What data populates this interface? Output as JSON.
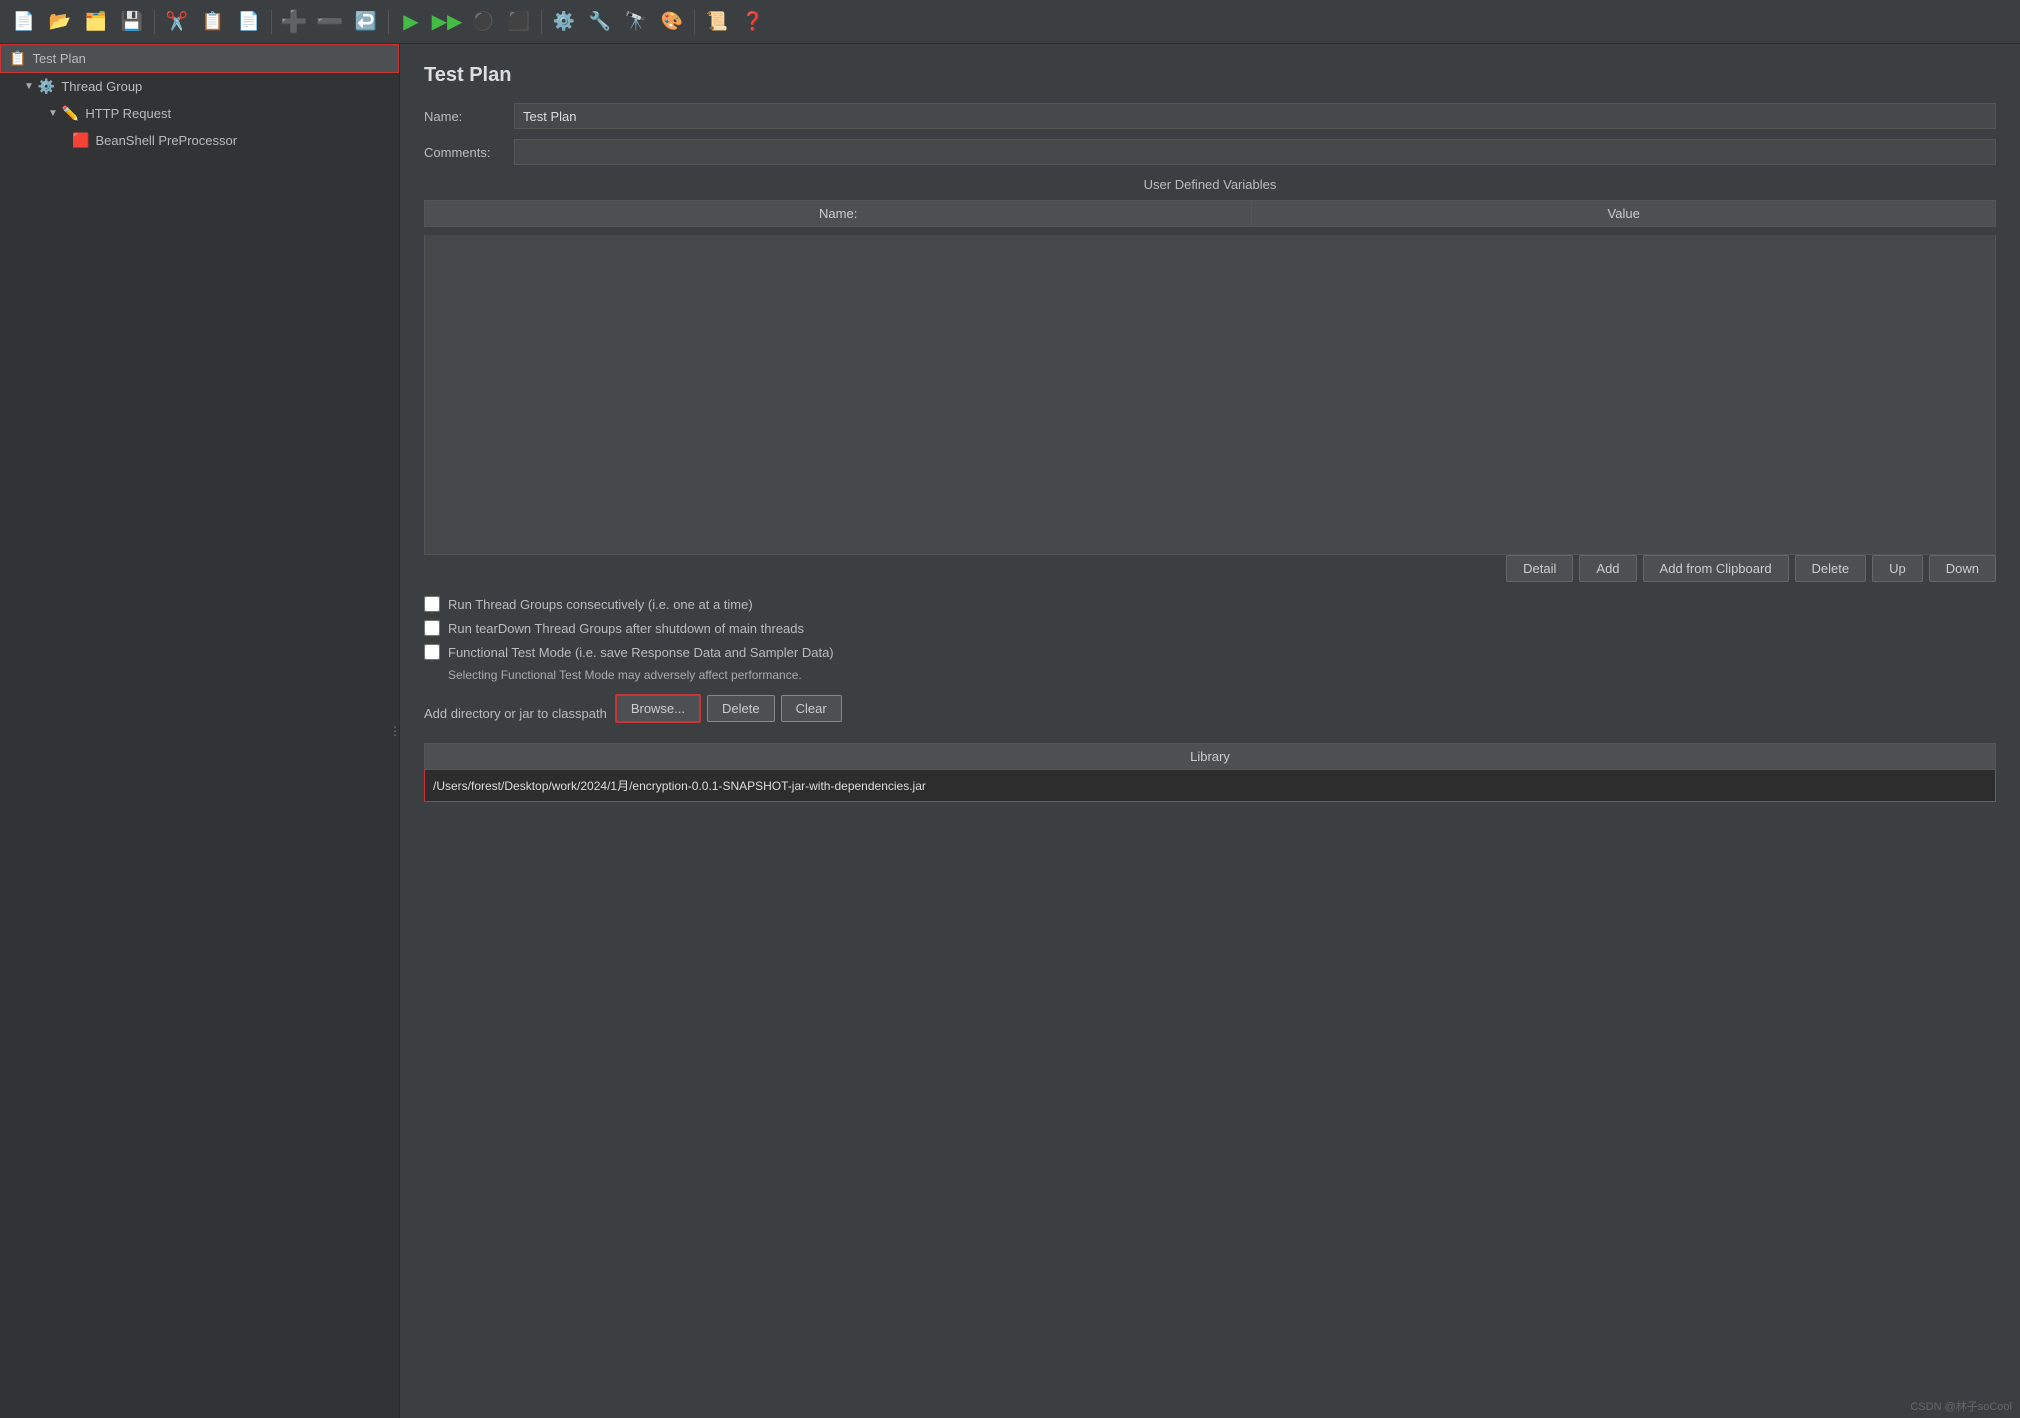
{
  "toolbar": {
    "buttons": [
      {
        "name": "new-icon",
        "icon": "📄"
      },
      {
        "name": "open-icon",
        "icon": "📂"
      },
      {
        "name": "save-copy-icon",
        "icon": "💾"
      },
      {
        "name": "save-icon",
        "icon": "💾"
      },
      {
        "name": "cut-icon",
        "icon": "✂️"
      },
      {
        "name": "copy-icon",
        "icon": "📋"
      },
      {
        "name": "paste-icon",
        "icon": "📋"
      },
      {
        "name": "add-icon",
        "icon": "➕"
      },
      {
        "name": "remove-icon",
        "icon": "➖"
      },
      {
        "name": "undo-icon",
        "icon": "↩️"
      },
      {
        "name": "run-icon",
        "icon": "▶️"
      },
      {
        "name": "run-remote-icon",
        "icon": "▶️"
      },
      {
        "name": "stop-icon",
        "icon": "⚫"
      },
      {
        "name": "stop-remote-icon",
        "icon": "⬛"
      },
      {
        "name": "settings-icon",
        "icon": "⚙️"
      },
      {
        "name": "plugin-icon",
        "icon": "🔌"
      },
      {
        "name": "binoculars-icon",
        "icon": "🔭"
      },
      {
        "name": "paint-icon",
        "icon": "🎨"
      },
      {
        "name": "script-icon",
        "icon": "📜"
      },
      {
        "name": "help-icon",
        "icon": "❓"
      }
    ]
  },
  "sidebar": {
    "items": [
      {
        "id": "test-plan",
        "label": "Test Plan",
        "indent": 0,
        "icon": "📋",
        "selected": true,
        "expand": ""
      },
      {
        "id": "thread-group",
        "label": "Thread Group",
        "indent": 1,
        "icon": "⚙️",
        "selected": false,
        "expand": "▼"
      },
      {
        "id": "http-request",
        "label": "HTTP Request",
        "indent": 2,
        "icon": "✏️",
        "selected": false,
        "expand": "▼"
      },
      {
        "id": "beanshell",
        "label": "BeanShell PreProcessor",
        "indent": 3,
        "icon": "🟥",
        "selected": false,
        "expand": ""
      }
    ]
  },
  "panel": {
    "title": "Test Plan",
    "name_label": "Name:",
    "name_value": "Test Plan",
    "comments_label": "Comments:",
    "comments_value": "",
    "variables_title": "User Defined Variables",
    "table": {
      "name_header": "Name:",
      "value_header": "Value"
    },
    "buttons": {
      "detail": "Detail",
      "add": "Add",
      "add_from_clipboard": "Add from Clipboard",
      "delete": "Delete",
      "up": "Up",
      "down": "Down"
    },
    "checkboxes": [
      {
        "id": "run-consecutive",
        "label": "Run Thread Groups consecutively (i.e. one at a time)",
        "checked": false
      },
      {
        "id": "run-teardown",
        "label": "Run tearDown Thread Groups after shutdown of main threads",
        "checked": false
      },
      {
        "id": "functional-test",
        "label": "Functional Test Mode (i.e. save Response Data and Sampler Data)",
        "checked": false
      }
    ],
    "functional_note": "Selecting Functional Test Mode may adversely affect performance.",
    "classpath_label": "Add directory or jar to classpath",
    "classpath_buttons": {
      "browse": "Browse...",
      "delete": "Delete",
      "clear": "Clear"
    },
    "library_title": "Library",
    "library_entry": "/Users/forest/Desktop/work/2024/1月/encryption-0.0.1-SNAPSHOT-jar-with-dependencies.jar"
  },
  "footer": {
    "watermark": "CSDN @林子soCool"
  }
}
